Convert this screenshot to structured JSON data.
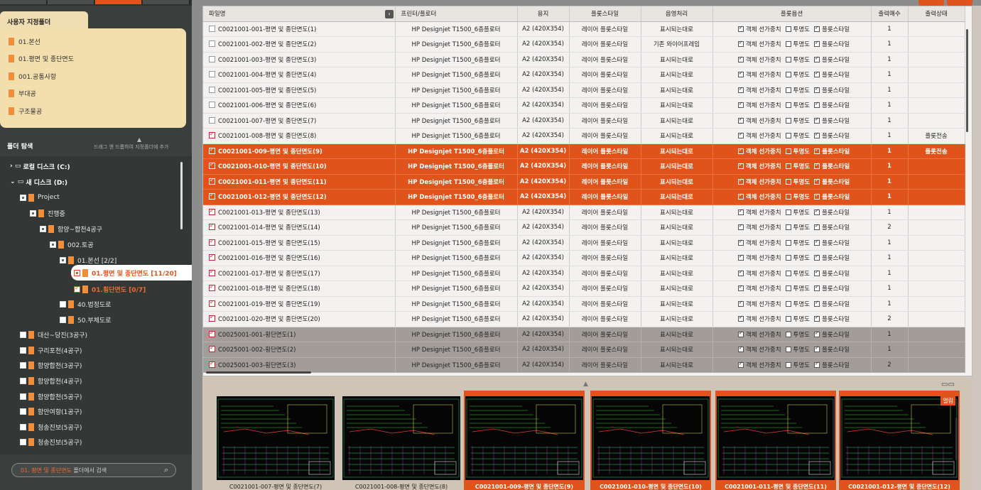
{
  "sidebar": {
    "custom_title": "사용자 지정폴더",
    "favorites": [
      "01.본선",
      "01.평면 및 종단면도",
      "001.공통사항",
      "부대공",
      "구조물공"
    ],
    "nav_title": "폴더 탐색",
    "nav_hint": "드래그 앤 드롭하여 지정폴더에 추가",
    "tree": [
      {
        "label": "로컬 디스크 (C:)"
      },
      {
        "label": "새 디스크 (D:)"
      },
      {
        "label": "Project"
      },
      {
        "label": "진행중"
      },
      {
        "label": "함양~합천4공구"
      },
      {
        "label": "002.토공"
      },
      {
        "label": "01.본선 [2/2]"
      },
      {
        "label": "01.평면 및 종단면도 [11/20]"
      },
      {
        "label": "01.횡단면도 [0/7]"
      },
      {
        "label": "40.법정도로"
      },
      {
        "label": "50.부체도로"
      },
      {
        "label": "대산~당진(3공구)"
      },
      {
        "label": "구리포천(4공구)"
      },
      {
        "label": "함양합천(3공구)"
      },
      {
        "label": "함양합천(4공구)"
      },
      {
        "label": "함양합천(5공구)"
      },
      {
        "label": "함안여항(1공구)"
      },
      {
        "label": "청송진보(5공구)"
      },
      {
        "label": "청송진보(5공구)"
      }
    ],
    "search": {
      "highlight": "01. 평면 및 종단면도",
      "rest": " 폴더에서 검색"
    }
  },
  "table": {
    "headers": [
      "파일명",
      "프린터/플로터",
      "용지",
      "플롯스타일",
      "음영처리",
      "플롯옵션",
      "출력매수",
      "출력상태"
    ],
    "rows": [
      {
        "name": "C0021001-001-평면 및 종단면도(1)",
        "printer": "HP Designjet T1500_6층플로터",
        "paper": "A2 (420X354)",
        "style": "레이어 플롯스타일",
        "shade": "표시되는대로",
        "copies": "1",
        "status": "",
        "checked": false,
        "kind": "n",
        "opt2": false
      },
      {
        "name": "C0021001-002-평면 및 종단면도(2)",
        "printer": "HP Designjet T1500_6층플로터",
        "paper": "A2 (420X354)",
        "style": "레이어 플롯스타일",
        "shade": "기존 와이어프레임",
        "copies": "1",
        "status": "",
        "checked": false,
        "kind": "n",
        "opt2": false
      },
      {
        "name": "C0021001-003-평면 및 종단면도(3)",
        "printer": "HP Designjet T1500_6층플로터",
        "paper": "A2 (420X354)",
        "style": "레이어 플롯스타일",
        "shade": "표시되는대로",
        "copies": "1",
        "status": "",
        "checked": false,
        "kind": "n",
        "opt2": false
      },
      {
        "name": "C0021001-004-평면 및 종단면도(4)",
        "printer": "HP Designjet T1500_6층플로터",
        "paper": "A2 (420X354)",
        "style": "레이어 플롯스타일",
        "shade": "표시되는대로",
        "copies": "1",
        "status": "",
        "checked": false,
        "kind": "n",
        "opt2": false
      },
      {
        "name": "C0021001-005-평면 및 종단면도(5)",
        "printer": "HP Designjet T1500_6층플로터",
        "paper": "A2 (420X354)",
        "style": "레이어 플롯스타일",
        "shade": "표시되는대로",
        "copies": "1",
        "status": "",
        "checked": false,
        "kind": "n",
        "opt2": false
      },
      {
        "name": "C0021001-006-평면 및 종단면도(6)",
        "printer": "HP Designjet T1500_6층플로터",
        "paper": "A2 (420X354)",
        "style": "레이어 플롯스타일",
        "shade": "표시되는대로",
        "copies": "1",
        "status": "",
        "checked": false,
        "kind": "n",
        "opt2": false
      },
      {
        "name": "C0021001-007-평면 및 종단면도(7)",
        "printer": "HP Designjet T1500_6층플로터",
        "paper": "A2 (420X354)",
        "style": "레이어 플롯스타일",
        "shade": "표시되는대로",
        "copies": "1",
        "status": "",
        "checked": false,
        "kind": "n",
        "opt2": false
      },
      {
        "name": "C0021001-008-평면 및 종단면도(8)",
        "printer": "HP Designjet T1500_6층플로터",
        "paper": "A2 (420X354)",
        "style": "레이어 플롯스타일",
        "shade": "표시되는대로",
        "copies": "1",
        "status": "플롯전송",
        "checked": true,
        "kind": "n",
        "opt2": false
      },
      {
        "name": "C0021001-009-평면 및 종단면도(9)",
        "printer": "HP Designjet T1500_6층플로터",
        "paper": "A2 (420X354)",
        "style": "레이어 플롯스타일",
        "shade": "표시되는대로",
        "copies": "1",
        "status": "플롯전송",
        "checked": true,
        "kind": "s",
        "opt2": false
      },
      {
        "name": "C0021001-010-평면 및 종단면도(10)",
        "printer": "HP Designjet T1500_6층플로터",
        "paper": "A2 (420X354)",
        "style": "레이어 플롯스타일",
        "shade": "표시되는대로",
        "copies": "1",
        "status": "",
        "checked": true,
        "kind": "s",
        "opt2": false
      },
      {
        "name": "C0021001-011-평면 및 종단면도(11)",
        "printer": "HP Designjet T1500_6층플로터",
        "paper": "A2 (420X354)",
        "style": "레이어 플롯스타일",
        "shade": "표시되는대로",
        "copies": "1",
        "status": "",
        "checked": true,
        "kind": "s",
        "opt2": false
      },
      {
        "name": "C0021001-012-평면 및 종단면도(12)",
        "printer": "HP Designjet T1500_6층플로터",
        "paper": "A2 (420X354)",
        "style": "레이어 플롯스타일",
        "shade": "표시되는대로",
        "copies": "1",
        "status": "",
        "checked": true,
        "kind": "s",
        "opt2": false
      },
      {
        "name": "C0021001-013-평면 및 종단면도(13)",
        "printer": "HP Designjet T1500_6층플로터",
        "paper": "A2 (420X354)",
        "style": "레이어 플롯스타일",
        "shade": "표시되는대로",
        "copies": "1",
        "status": "",
        "checked": true,
        "kind": "n",
        "opt2": false
      },
      {
        "name": "C0021001-014-평면 및 종단면도(14)",
        "printer": "HP Designjet T1500_6층플로터",
        "paper": "A2 (420X354)",
        "style": "레이어 플롯스타일",
        "shade": "표시되는대로",
        "copies": "2",
        "status": "",
        "checked": true,
        "kind": "n",
        "opt2": false
      },
      {
        "name": "C0021001-015-평면 및 종단면도(15)",
        "printer": "HP Designjet T1500_6층플로터",
        "paper": "A2 (420X354)",
        "style": "레이어 플롯스타일",
        "shade": "표시되는대로",
        "copies": "1",
        "status": "",
        "checked": true,
        "kind": "n",
        "opt2": false
      },
      {
        "name": "C0021001-016-평면 및 종단면도(16)",
        "printer": "HP Designjet T1500_6층플로터",
        "paper": "A2 (420X354)",
        "style": "레이어 플롯스타일",
        "shade": "표시되는대로",
        "copies": "1",
        "status": "",
        "checked": true,
        "kind": "n",
        "opt2": false
      },
      {
        "name": "C0021001-017-평면 및 종단면도(17)",
        "printer": "HP Designjet T1500_6층플로터",
        "paper": "A2 (420X354)",
        "style": "레이어 플롯스타일",
        "shade": "표시되는대로",
        "copies": "1",
        "status": "",
        "checked": true,
        "kind": "n",
        "opt2": false
      },
      {
        "name": "C0021001-018-평면 및 종단면도(18)",
        "printer": "HP Designjet T1500_6층플로터",
        "paper": "A2 (420X354)",
        "style": "레이어 플롯스타일",
        "shade": "표시되는대로",
        "copies": "1",
        "status": "",
        "checked": true,
        "kind": "n",
        "opt2": false
      },
      {
        "name": "C0021001-019-평면 및 종단면도(19)",
        "printer": "HP Designjet T1500_6층플로터",
        "paper": "A2 (420X354)",
        "style": "레이어 플롯스타일",
        "shade": "표시되는대로",
        "copies": "1",
        "status": "",
        "checked": true,
        "kind": "n",
        "opt2": false
      },
      {
        "name": "C0021001-020-평면 및 종단면도(20)",
        "printer": "HP Designjet T1500_6층플로터",
        "paper": "A2 (420X354)",
        "style": "레이어 플롯스타일",
        "shade": "표시되는대로",
        "copies": "2",
        "status": "",
        "checked": true,
        "kind": "n",
        "opt2": false
      },
      {
        "name": "C0025001-001-횡단면도(1)",
        "printer": "HP Designjet T1500_6층플로터",
        "paper": "A2 (420X354)",
        "style": "레이어 플롯스타일",
        "shade": "표시되는대로",
        "copies": "1",
        "status": "",
        "checked": true,
        "kind": "g",
        "opt2": false
      },
      {
        "name": "C0025001-002-횡단면도(2)",
        "printer": "HP Designjet T1500_6층플로터",
        "paper": "A2 (420X354)",
        "style": "레이어 플롯스타일",
        "shade": "표시되는대로",
        "copies": "1",
        "status": "",
        "checked": true,
        "kind": "g",
        "opt2": false
      },
      {
        "name": "C0025001-003-횡단면도(3)",
        "printer": "HP Designjet T1500_6층플로터",
        "paper": "A2 (420X354)",
        "style": "레이어 플롯스타일",
        "shade": "표시되는대로",
        "copies": "2",
        "status": "",
        "checked": true,
        "kind": "g",
        "opt2": false
      }
    ],
    "opt_labels": [
      "객체 선가중치",
      "투명도",
      "플롯스타일"
    ]
  },
  "preview": {
    "thumbs": [
      {
        "caption": "C0021001-007-평면 및 종단면도(7)",
        "selected": false
      },
      {
        "caption": "C0021001-008-평면 및 종단면도(8)",
        "selected": false
      },
      {
        "caption": "C0021001-009-평면 및 종단면도(9)",
        "selected": true
      },
      {
        "caption": "C0021001-010-평면 및 종단면도(10)",
        "selected": true
      },
      {
        "caption": "C0021001-011-평면 및 종단면도(11)",
        "selected": true
      },
      {
        "caption": "C0021001-012-평면 및 종단면도(12)",
        "selected": true,
        "badge": "열림"
      }
    ]
  },
  "colors": {
    "accent": "#e0531a",
    "sidebar": "#3a3f3d",
    "favorite_bg": "#f3deae"
  }
}
